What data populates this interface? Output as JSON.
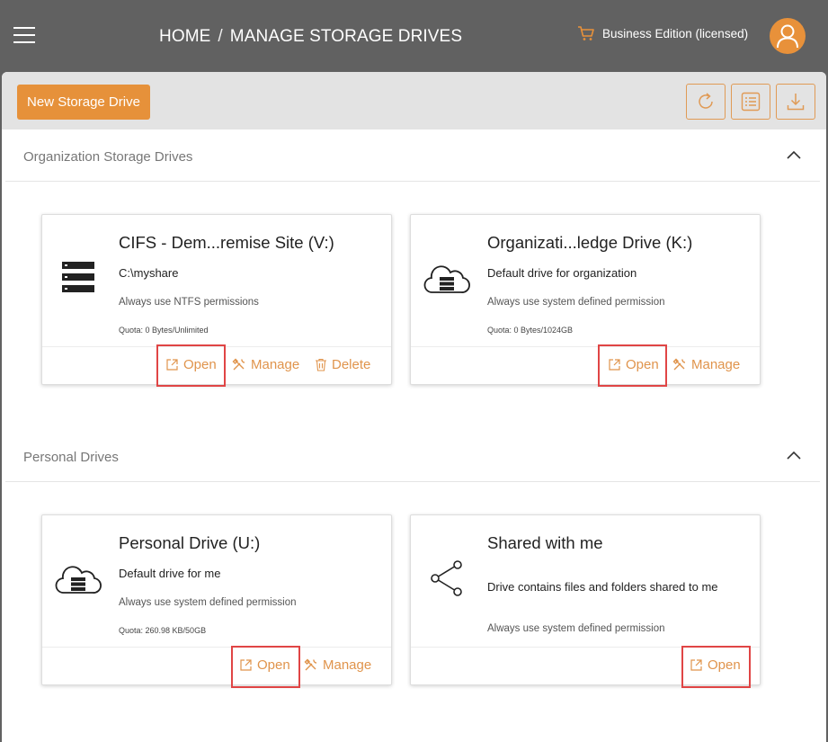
{
  "header": {
    "breadcrumb": [
      "HOME",
      "MANAGE STORAGE DRIVES"
    ],
    "separator": "/",
    "edition": "Business Edition (licensed)"
  },
  "toolbar": {
    "new_button": "New Storage Drive",
    "tools": [
      "refresh-icon",
      "list-view-icon",
      "download-icon"
    ]
  },
  "sections": [
    {
      "title": "Organization Storage Drives",
      "cards": [
        {
          "title": "CIFS - Dem...remise Site  (V:)",
          "icon": "server-icon",
          "description": "C:\\myshare",
          "permission": "Always use NTFS permissions",
          "quota": "Quota: 0 Bytes/Unlimited",
          "actions": [
            "Open",
            "Manage",
            "Delete"
          ]
        },
        {
          "title": "Organizati...ledge Drive  (K:)",
          "icon": "cloud-storage-icon",
          "description": "Default drive for organization",
          "permission": "Always use system defined permission",
          "quota": "Quota: 0 Bytes/1024GB",
          "actions": [
            "Open",
            "Manage"
          ]
        }
      ]
    },
    {
      "title": "Personal Drives",
      "cards": [
        {
          "title": "Personal Drive  (U:)",
          "icon": "cloud-storage-icon",
          "description": "Default drive for me",
          "permission": "Always use system defined permission",
          "quota": "Quota: 260.98 KB/50GB",
          "actions": [
            "Open",
            "Manage"
          ]
        },
        {
          "title": "Shared with me",
          "icon": "share-icon",
          "description": "Drive contains files and folders shared to me",
          "permission": "Always use system defined permission",
          "quota": "",
          "actions": [
            "Open"
          ]
        }
      ]
    }
  ],
  "colors": {
    "accent": "#e6913a",
    "header_bg": "#616161",
    "toolbar_bg": "#e3e3e3",
    "highlight": "#e04545"
  }
}
